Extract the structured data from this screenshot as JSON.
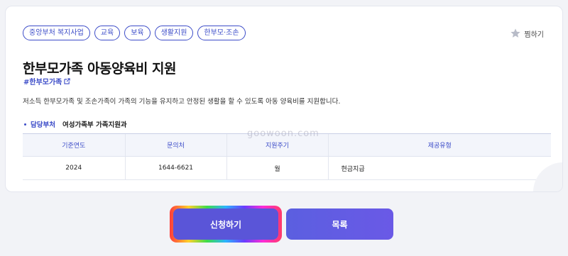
{
  "tags": [
    "중앙부처 복지사업",
    "교육",
    "보육",
    "생활지원",
    "한부모·조손"
  ],
  "bookmark_label": "찜하기",
  "title": "한부모가족 아동양육비 지원",
  "hashtag": "#한부모가족",
  "description": "저소득 한부모가족 및 조손가족이 가족의 기능을 유지하고 안정된 생활을 할 수 있도록 아동 양육비를 지원합니다.",
  "department": {
    "label": "담당부처",
    "value": "여성가족부 가족지원과"
  },
  "table": {
    "headers": [
      "기준연도",
      "문의처",
      "지원주기",
      "제공유형"
    ],
    "row": [
      "2024",
      "1644-6621",
      "월",
      "현금지급"
    ]
  },
  "watermark": "goowoon.com",
  "buttons": {
    "apply": "신청하기",
    "list": "목록"
  },
  "colors": {
    "accent": "#3c4cc8",
    "button": "#5a55d8"
  },
  "icons": {
    "bookmark": "star-icon",
    "hashtag_link": "external-link-icon"
  }
}
